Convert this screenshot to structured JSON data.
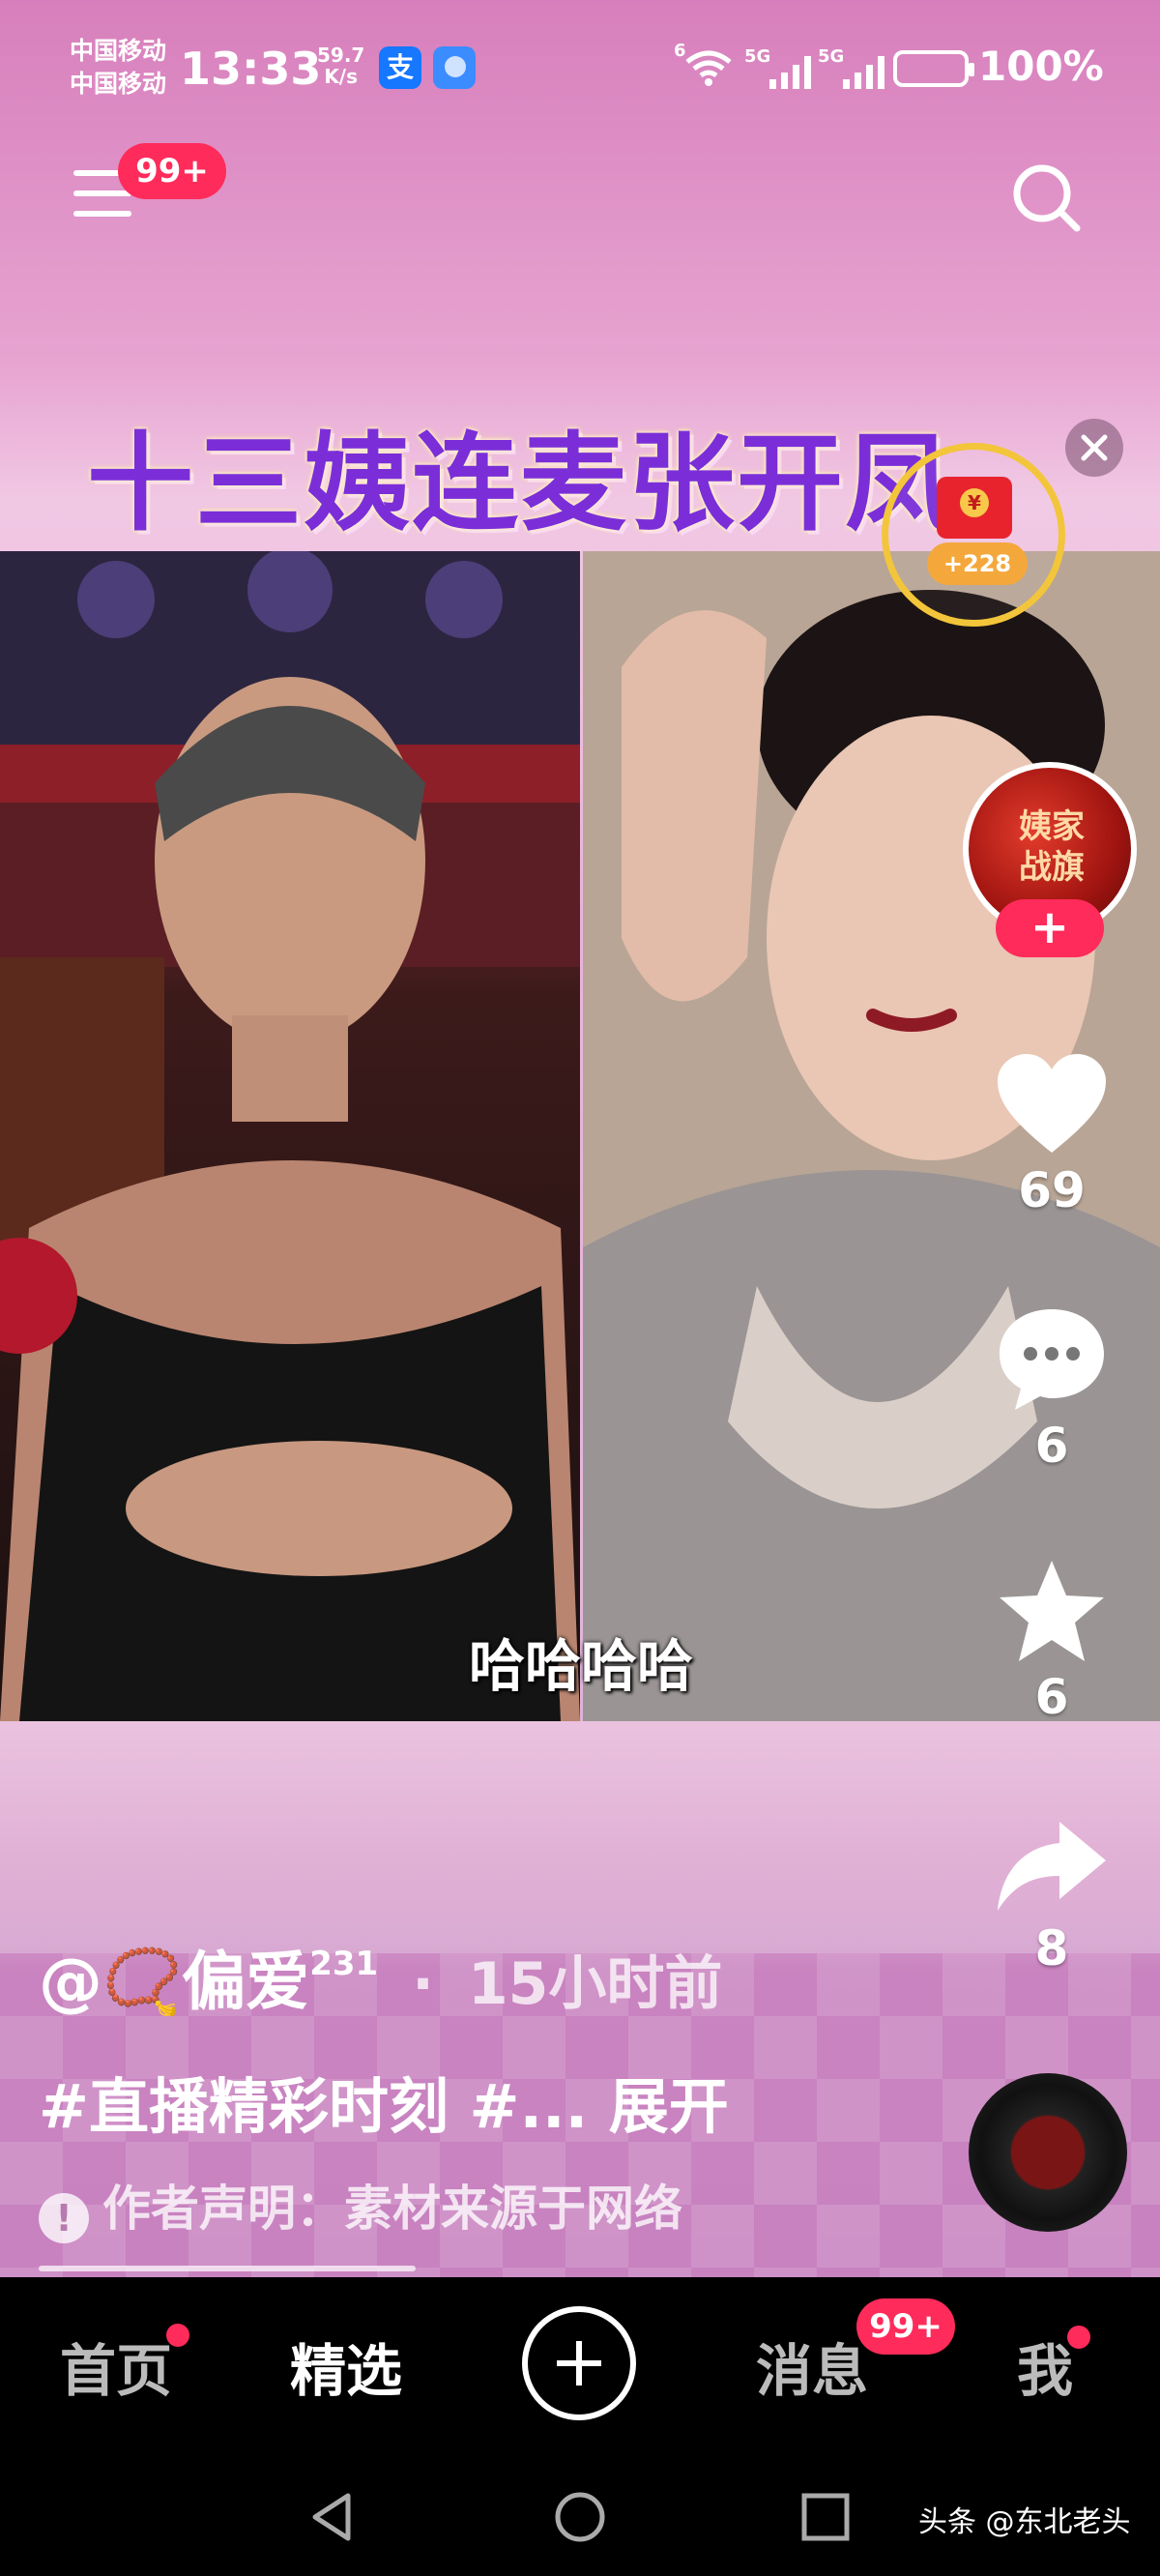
{
  "status_bar": {
    "carrier_1": "中国移动",
    "carrier_2": "中国移动",
    "time": "13:33",
    "net_speed_value": "59.7",
    "net_speed_unit": "K/s",
    "alipay_label": "支",
    "signal_1_tag": "5G",
    "signal_2_tag": "5G",
    "wifi_tag": "6",
    "battery": "100%"
  },
  "top_bar": {
    "menu_badge": "99+",
    "menu_icon": "menu-icon",
    "search_icon": "search-icon"
  },
  "video": {
    "title_overlay": "十三姨连麦张开凤",
    "subtitle": "哈哈哈哈",
    "red_packet_reward": "+228"
  },
  "actions": {
    "avatar_text": "姨家战旗",
    "follow_label": "+",
    "likes": "69",
    "comments": "6",
    "favorites": "6",
    "shares": "8"
  },
  "caption": {
    "author": "@📿偏爱",
    "author_sup": "231",
    "separator": "·",
    "time_ago": "15小时前",
    "hashtags": "#直播精彩时刻 #... 展开",
    "disclaimer_icon": "!",
    "disclaimer": "作者声明：素材来源于网络"
  },
  "bottom_nav": {
    "items": [
      {
        "label": "首页"
      },
      {
        "label": "精选"
      },
      {
        "label": "消息"
      },
      {
        "label": "我"
      }
    ],
    "message_badge": "99+"
  },
  "watermark": "头条 @东北老头",
  "colors": {
    "accent": "#ff2b5a",
    "gold": "#f3c53a",
    "nav_bg": "#000000"
  }
}
